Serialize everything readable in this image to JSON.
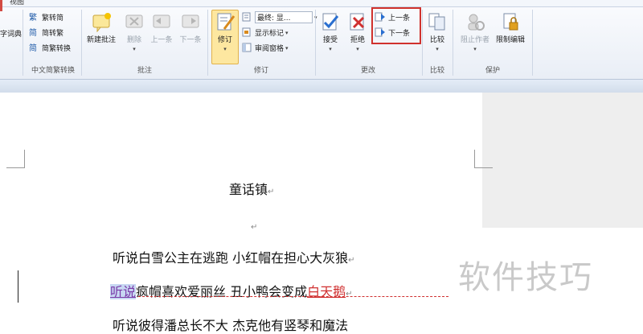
{
  "tabs": {
    "view": "视图"
  },
  "ribbon": {
    "dict_fragment": "字词典",
    "chinese_conv": {
      "to_simplified": "繁转简",
      "to_traditional": "简转繁",
      "convert": "简繁转换",
      "group_label": "中文简繁转换"
    },
    "comments": {
      "new_comment": "新建批注",
      "delete": "删除",
      "prev": "上一条",
      "next": "下一条",
      "group_label": "批注"
    },
    "tracking": {
      "revision": "修订",
      "final_display": "最终: 显...",
      "show_markup": "显示标记",
      "review_pane": "审阅窗格",
      "group_label": "修订"
    },
    "changes": {
      "accept": "接受",
      "reject": "拒绝",
      "prev_change": "上一条",
      "next_change": "下一条",
      "group_label": "更改"
    },
    "compare": {
      "compare": "比较",
      "group_label": "比较"
    },
    "protect": {
      "block_authors": "阻止作者",
      "restrict_editing": "限制编辑",
      "group_label": "保护"
    }
  },
  "colors": {
    "accent": "#d0322d",
    "revision_active": "#fde7a0",
    "insert_red": "#d03030",
    "selection": "#c7d7f2"
  },
  "document": {
    "title": "童话镇",
    "para_mark": "↵",
    "line1": "听说白雪公主在逃跑  小红帽在担心大灰狼",
    "line2_sel": "听说",
    "line2_mid": "疯帽喜欢爱丽丝  丑小鸭会变成",
    "line2_ins": "白天鹅",
    "line3": "听说彼得潘总长不大  杰克他有竖琴和魔法"
  },
  "watermark": "软件技巧"
}
